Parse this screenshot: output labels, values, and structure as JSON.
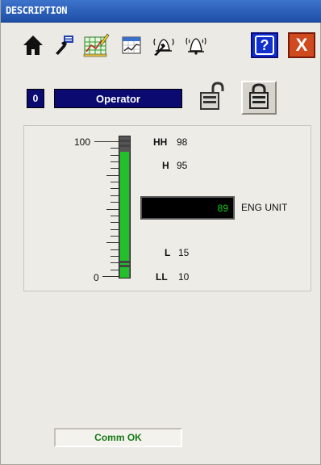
{
  "window": {
    "title": "DESCRIPTION"
  },
  "toolbar": {
    "buttons": [
      {
        "name": "home-icon"
      },
      {
        "name": "wrench-icon"
      },
      {
        "name": "trend-edit-icon"
      },
      {
        "name": "calendar-trend-icon"
      },
      {
        "name": "alarm-ack-icon"
      },
      {
        "name": "bell-icon"
      },
      {
        "name": "help-icon",
        "label": "?"
      },
      {
        "name": "close-icon",
        "label": "X"
      }
    ]
  },
  "user": {
    "level": "0",
    "role": "Operator"
  },
  "gauge": {
    "scale_max_label": "100",
    "scale_min_label": "0",
    "range": [
      0,
      100
    ],
    "value_fraction": 0.89,
    "alarms": {
      "hh": {
        "label": "HH",
        "value": "98"
      },
      "h": {
        "label": "H",
        "value": "95"
      },
      "l": {
        "label": "L",
        "value": "15"
      },
      "ll": {
        "label": "LL",
        "value": "10"
      }
    },
    "readout": "89",
    "unit": "ENG UNIT",
    "colors": {
      "bar": "#22c02a",
      "readout_text": "#18d018"
    }
  },
  "status": {
    "text": "Comm OK"
  }
}
